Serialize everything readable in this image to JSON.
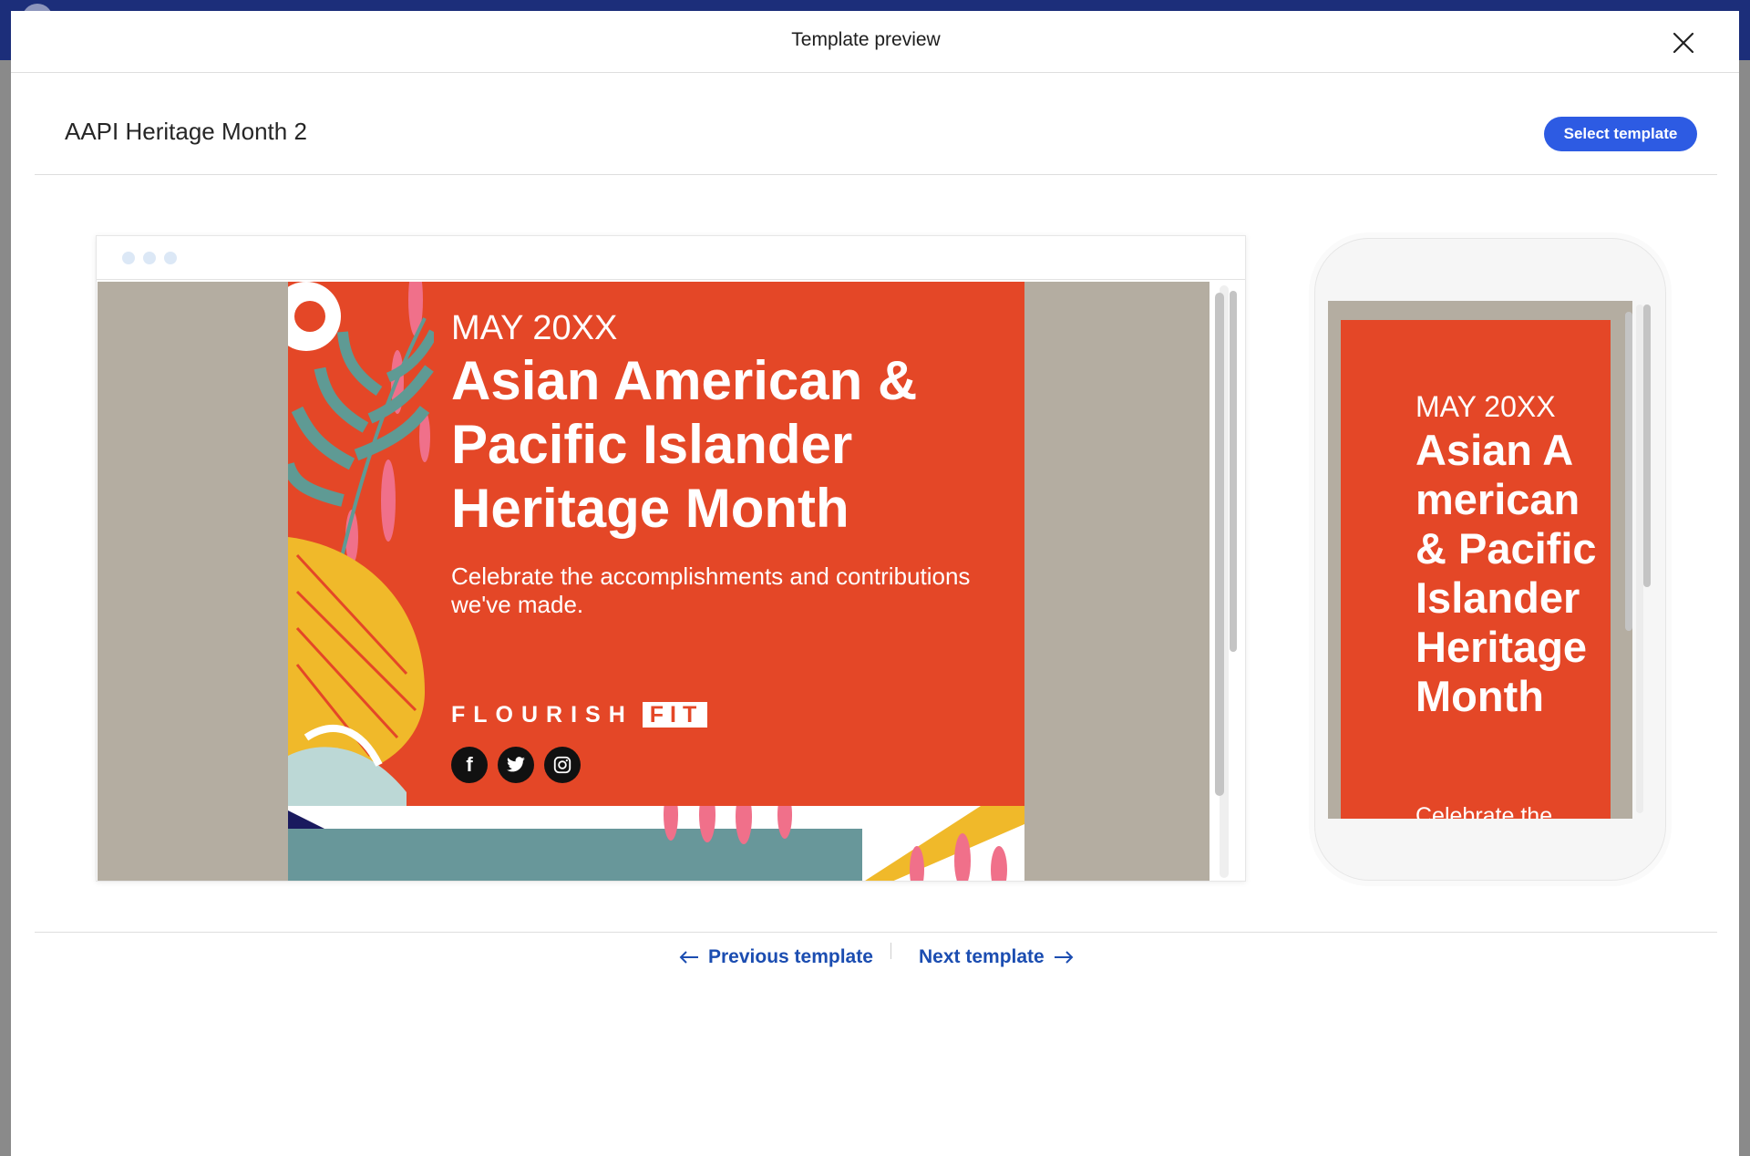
{
  "modal": {
    "title": "Template preview"
  },
  "template": {
    "name": "AAPI Heritage Month 2",
    "select_label": "Select template"
  },
  "email": {
    "date_label": "MAY 20XX",
    "headline": "Asian American & Pacific Islander Heritage Month",
    "subtext": "Celebrate the accomplishments and contributions we've made.",
    "brand_word": "FLOURISH",
    "brand_badge": "FIT",
    "socials": [
      "facebook-icon",
      "twitter-icon",
      "instagram-icon"
    ]
  },
  "mobile": {
    "date_label": "MAY 20XX",
    "headline": "Asian American & Pacific Islander Heritage Month",
    "subtext_partial": "Celebrate the"
  },
  "nav": {
    "previous_label": "Previous template",
    "next_label": "Next template"
  },
  "colors": {
    "brand_blue": "#2d5be3",
    "link_blue": "#1b4db1",
    "email_orange": "#e44727",
    "background_taupe": "#b4ada1"
  }
}
